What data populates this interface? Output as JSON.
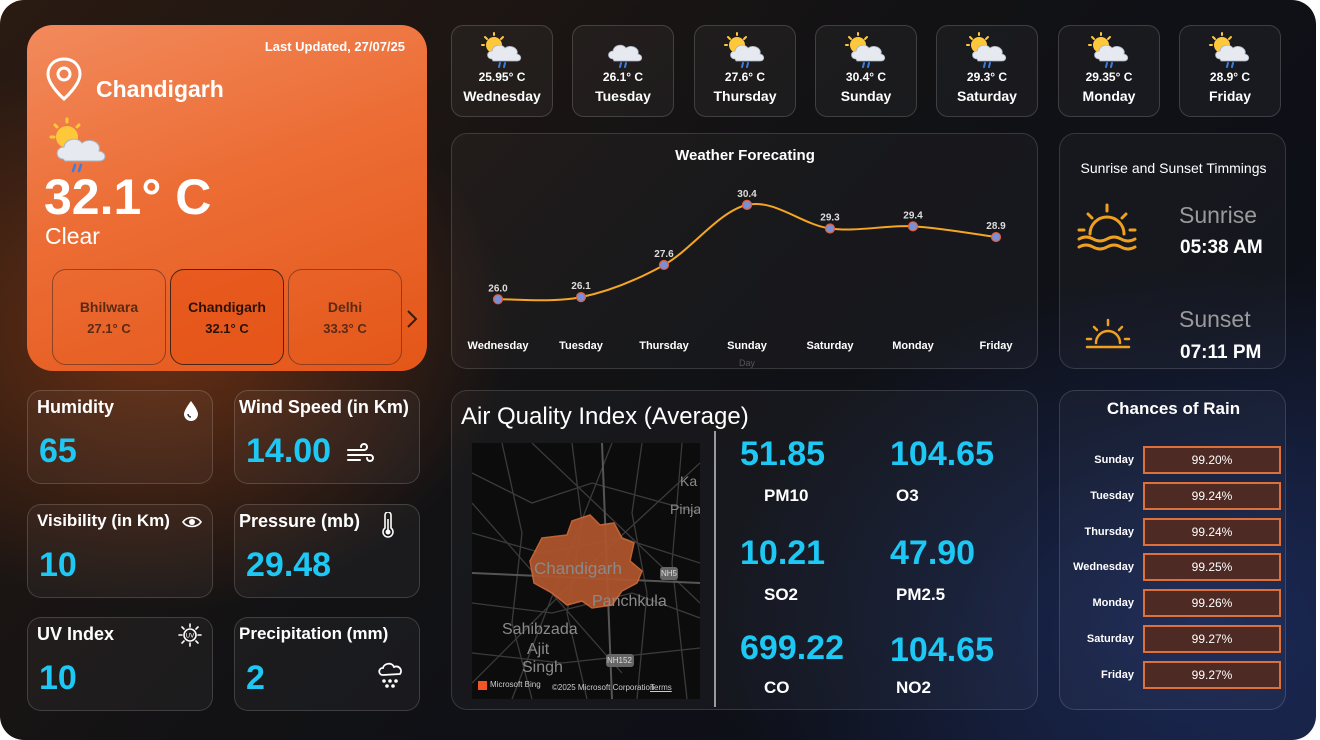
{
  "current": {
    "last_updated": "Last Updated, 27/07/25",
    "city": "Chandigarh",
    "temperature": "32.1° C",
    "condition": "Clear",
    "icon": "partly-cloudy-rain-icon"
  },
  "cities": [
    {
      "name": "Bhilwara",
      "temp": "27.1° C"
    },
    {
      "name": "Chandigarh",
      "temp": "32.1° C"
    },
    {
      "name": "Delhi",
      "temp": "33.3° C"
    }
  ],
  "forecast_tiles": [
    {
      "temp": "25.95° C",
      "day": "Wednesday",
      "icon": "sun-cloud-rain-icon"
    },
    {
      "temp": "26.1° C",
      "day": "Tuesday",
      "icon": "cloud-rain-icon"
    },
    {
      "temp": "27.6° C",
      "day": "Thursday",
      "icon": "sun-cloud-rain-icon"
    },
    {
      "temp": "30.4° C",
      "day": "Sunday",
      "icon": "sun-cloud-rain-icon"
    },
    {
      "temp": "29.3° C",
      "day": "Saturday",
      "icon": "sun-cloud-rain-icon"
    },
    {
      "temp": "29.35° C",
      "day": "Monday",
      "icon": "sun-cloud-rain-icon"
    },
    {
      "temp": "28.9° C",
      "day": "Friday",
      "icon": "sun-cloud-rain-icon"
    }
  ],
  "chart_data": {
    "type": "line",
    "title": "Weather Forecating",
    "xlabel": "Day",
    "ylabel": "",
    "categories": [
      "Wednesday",
      "Tuesday",
      "Thursday",
      "Sunday",
      "Saturday",
      "Monday",
      "Friday"
    ],
    "values": [
      26.0,
      26.1,
      27.6,
      30.4,
      29.3,
      29.4,
      28.9
    ],
    "data_labels": [
      "26.0",
      "26.1",
      "27.6",
      "30.4",
      "29.3",
      "29.4",
      "28.9"
    ],
    "ylim": [
      25.5,
      31
    ],
    "grid": false,
    "line_color": "#f5a623",
    "marker_color": "#7b8fd6"
  },
  "sun": {
    "title": "Sunrise and Sunset Timmings",
    "sunrise_label": "Sunrise",
    "sunrise_time": "05:38 AM",
    "sunset_label": "Sunset",
    "sunset_time": "07:11 PM"
  },
  "metrics": {
    "humidity": {
      "label": "Humidity",
      "value": "65",
      "icon": "droplet-icon"
    },
    "wind": {
      "label": "Wind Speed (in Km)",
      "value": "14.00",
      "icon": "wind-icon"
    },
    "visibility": {
      "label": "Visibility (in Km)",
      "value": "10",
      "icon": "eye-icon"
    },
    "pressure": {
      "label": "Pressure (mb)",
      "value": "29.48",
      "icon": "thermometer-icon"
    },
    "uv": {
      "label": "UV Index",
      "value": "10",
      "icon": "uv-sun-icon"
    },
    "precipitation": {
      "label": "Precipitation (mm)",
      "value": "2",
      "icon": "cloud-rain-icon"
    }
  },
  "aqi": {
    "title": "Air Quality Index (Average)",
    "map_labels": {
      "city": "Chandigarh",
      "panchkula": "Panchkula",
      "sahibzada": "Sahibzada",
      "ajit": "Ajit",
      "singh": "Singh",
      "pinja": "Pinja",
      "ka": "Ka",
      "nh5": "NH5",
      "nh152": "NH152",
      "attribution": "©2025 Microsoft Corporation",
      "bing": "Microsoft Bing",
      "terms": "Terms"
    },
    "items": [
      {
        "value": "51.85",
        "label": "PM10"
      },
      {
        "value": "104.65",
        "label": "O3"
      },
      {
        "value": "10.21",
        "label": "SO2"
      },
      {
        "value": "47.90",
        "label": "PM2.5"
      },
      {
        "value": "699.22",
        "label": "CO"
      },
      {
        "value": "104.65",
        "label": "NO2"
      }
    ]
  },
  "rain": {
    "title": "Chances of Rain",
    "rows": [
      {
        "day": "Sunday",
        "value": "99.20%"
      },
      {
        "day": "Tuesday",
        "value": "99.24%"
      },
      {
        "day": "Thursday",
        "value": "99.24%"
      },
      {
        "day": "Wednesday",
        "value": "99.25%"
      },
      {
        "day": "Monday",
        "value": "99.26%"
      },
      {
        "day": "Saturday",
        "value": "99.27%"
      },
      {
        "day": "Friday",
        "value": "99.27%"
      }
    ]
  },
  "colors": {
    "accent_value": "#1ec8f5",
    "orange_card": "#ec6d35",
    "rain_bar_border": "#e0703a",
    "rain_bar_fill": "#4e2a24"
  }
}
